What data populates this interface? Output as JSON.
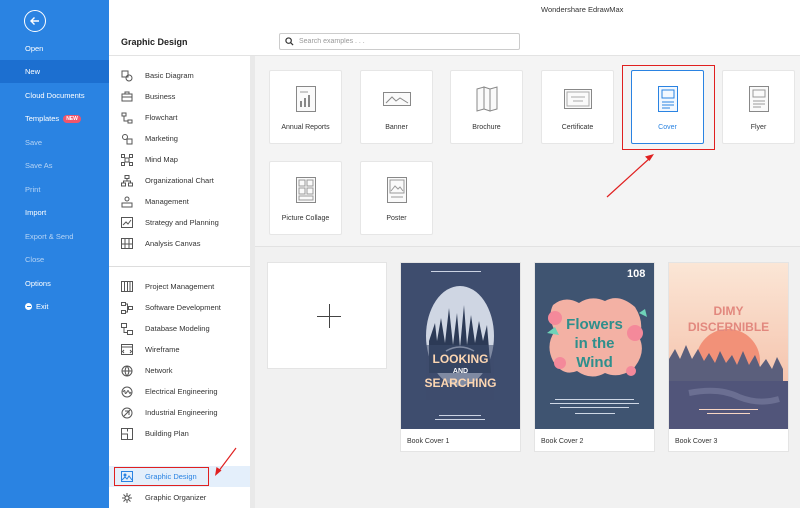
{
  "app": {
    "title": "Wondershare EdrawMax"
  },
  "left_menu": {
    "items": [
      {
        "label": "Open"
      },
      {
        "label": "New"
      },
      {
        "label": "Cloud Documents"
      },
      {
        "label": "Templates",
        "badge": "NEW"
      },
      {
        "label": "Save"
      },
      {
        "label": "Save As"
      },
      {
        "label": "Print"
      },
      {
        "label": "Import"
      },
      {
        "label": "Export & Send"
      },
      {
        "label": "Close"
      },
      {
        "label": "Options"
      },
      {
        "label": "Exit"
      }
    ]
  },
  "section": {
    "title": "Graphic Design"
  },
  "search": {
    "placeholder": "Search examples . . ."
  },
  "categories": [
    {
      "label": "Basic Diagram",
      "icon": "basic-diagram-icon"
    },
    {
      "label": "Business",
      "icon": "briefcase-icon"
    },
    {
      "label": "Flowchart",
      "icon": "flowchart-icon"
    },
    {
      "label": "Marketing",
      "icon": "marketing-icon"
    },
    {
      "label": "Mind Map",
      "icon": "mind-map-icon"
    },
    {
      "label": "Organizational Chart",
      "icon": "org-chart-icon"
    },
    {
      "label": "Management",
      "icon": "management-icon"
    },
    {
      "label": "Strategy and Planning",
      "icon": "strategy-icon"
    },
    {
      "label": "Analysis Canvas",
      "icon": "analysis-canvas-icon"
    },
    {
      "label": "Project Management",
      "icon": "project-management-icon"
    },
    {
      "label": "Software Development",
      "icon": "software-development-icon"
    },
    {
      "label": "Database Modeling",
      "icon": "database-icon"
    },
    {
      "label": "Wireframe",
      "icon": "wireframe-icon"
    },
    {
      "label": "Network",
      "icon": "network-icon"
    },
    {
      "label": "Electrical Engineering",
      "icon": "electrical-icon"
    },
    {
      "label": "Industrial Engineering",
      "icon": "industrial-icon"
    },
    {
      "label": "Building Plan",
      "icon": "building-plan-icon"
    },
    {
      "label": "Graphic Design",
      "icon": "graphic-design-icon"
    },
    {
      "label": "Graphic Organizer",
      "icon": "graphic-organizer-icon"
    }
  ],
  "types": [
    {
      "label": "Annual Reports",
      "icon": "annual-report-icon"
    },
    {
      "label": "Banner",
      "icon": "banner-icon"
    },
    {
      "label": "Brochure",
      "icon": "brochure-icon"
    },
    {
      "label": "Certificate",
      "icon": "certificate-icon"
    },
    {
      "label": "Cover",
      "icon": "cover-icon"
    },
    {
      "label": "Flyer",
      "icon": "flyer-icon"
    },
    {
      "label": "Picture Collage",
      "icon": "picture-collage-icon"
    },
    {
      "label": "Poster",
      "icon": "poster-icon"
    }
  ],
  "templates": [
    {
      "caption": "Book Cover 1",
      "cover_text": [
        "LOOKING",
        "AND",
        "SEARCHING"
      ]
    },
    {
      "caption": "Book Cover 2",
      "cover_text": [
        "108",
        "Flowers",
        "in the",
        "Wind"
      ]
    },
    {
      "caption": "Book Cover 3",
      "cover_text": [
        "DIMY",
        "DISCERNIBLE"
      ]
    }
  ],
  "colors": {
    "sidebar": "#2a83e2",
    "highlight": "#e02020",
    "selected": "#2a83e2"
  }
}
